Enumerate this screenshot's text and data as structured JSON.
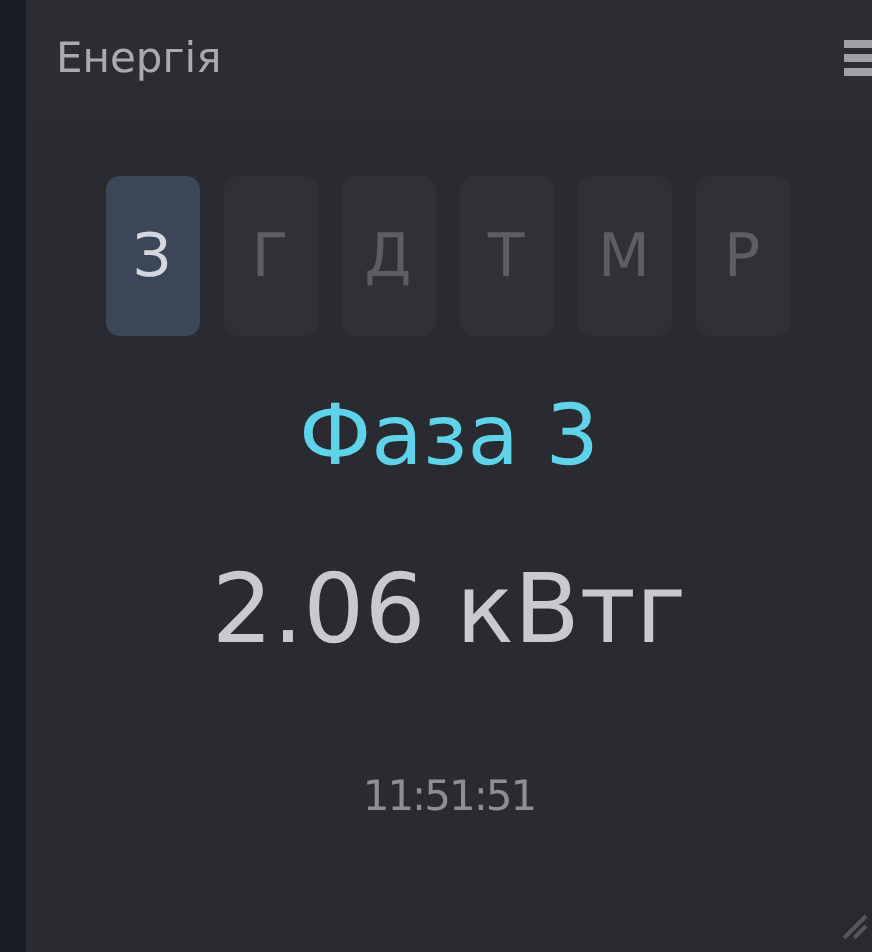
{
  "title": "Енергія",
  "tabs": [
    {
      "label": "З",
      "selected": true
    },
    {
      "label": "Г",
      "selected": false
    },
    {
      "label": "Д",
      "selected": false
    },
    {
      "label": "Т",
      "selected": false
    },
    {
      "label": "М",
      "selected": false
    },
    {
      "label": "Р",
      "selected": false
    }
  ],
  "phase": "Фаза 3",
  "value": "2.06 кВтг",
  "time": "11:51:51"
}
